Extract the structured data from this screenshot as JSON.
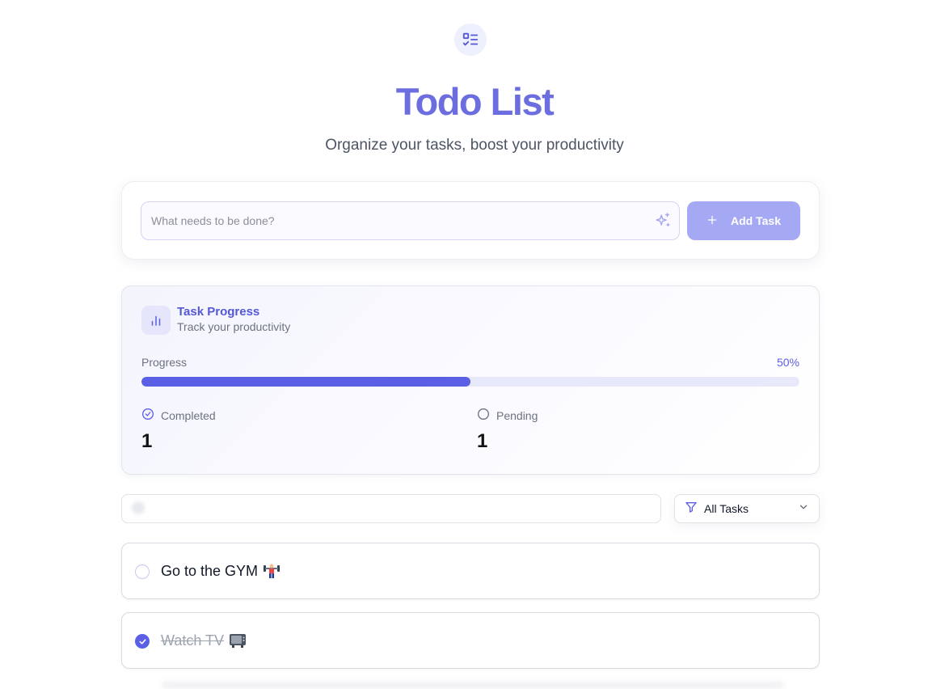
{
  "header": {
    "icon": "list-check-icon",
    "title": "Todo List",
    "subtitle": "Organize your tasks, boost your productivity"
  },
  "add_task": {
    "placeholder": "What needs to be done?",
    "value": "",
    "button_label": "Add Task",
    "button_icon": "plus-icon",
    "input_icon": "sparkle-icon"
  },
  "progress": {
    "title": "Task Progress",
    "subtitle": "Track your productivity",
    "label": "Progress",
    "percent_text": "50%",
    "percent_value": 0.5,
    "completed_label": "Completed",
    "completed_count": "1",
    "pending_label": "Pending",
    "pending_count": "1"
  },
  "filters": {
    "search_value": "",
    "selected": "All Tasks"
  },
  "tasks": [
    {
      "text": "Go to the GYM",
      "emoji": "weightlifter-emoji",
      "done": false
    },
    {
      "text": "Watch TV",
      "emoji": "television-emoji",
      "done": true
    }
  ],
  "colors": {
    "accent": "#5b5fe6",
    "title": "#6c6ee0",
    "button_disabled": "#a5a8f2"
  }
}
